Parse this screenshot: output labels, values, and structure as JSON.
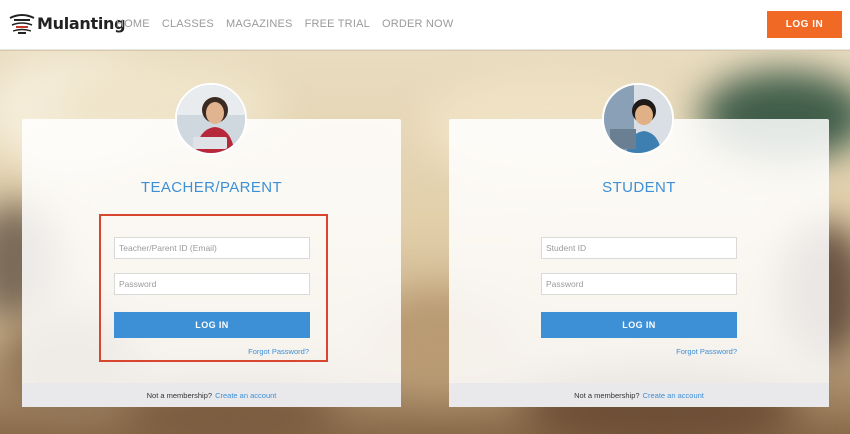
{
  "header": {
    "brand": "Mulanting",
    "nav": [
      "HOME",
      "CLASSES",
      "MAGAZINES",
      "FREE TRIAL",
      "ORDER NOW"
    ],
    "login_label": "LOG IN"
  },
  "colors": {
    "accent_orange": "#f16a25",
    "accent_blue": "#3d8fd6",
    "highlight_red": "#d9462f"
  },
  "teacher": {
    "title": "TEACHER/PARENT",
    "id_placeholder": "Teacher/Parent ID (Email)",
    "password_placeholder": "Password",
    "login_label": "LOG IN",
    "forgot_label": "Forgot Password?",
    "membership_text": "Not a membership?",
    "create_label": "Create an account"
  },
  "student": {
    "title": "STUDENT",
    "id_placeholder": "Student ID",
    "password_placeholder": "Password",
    "login_label": "LOG IN",
    "forgot_label": "Forgot Password?",
    "membership_text": "Not a membership?",
    "create_label": "Create an account"
  }
}
